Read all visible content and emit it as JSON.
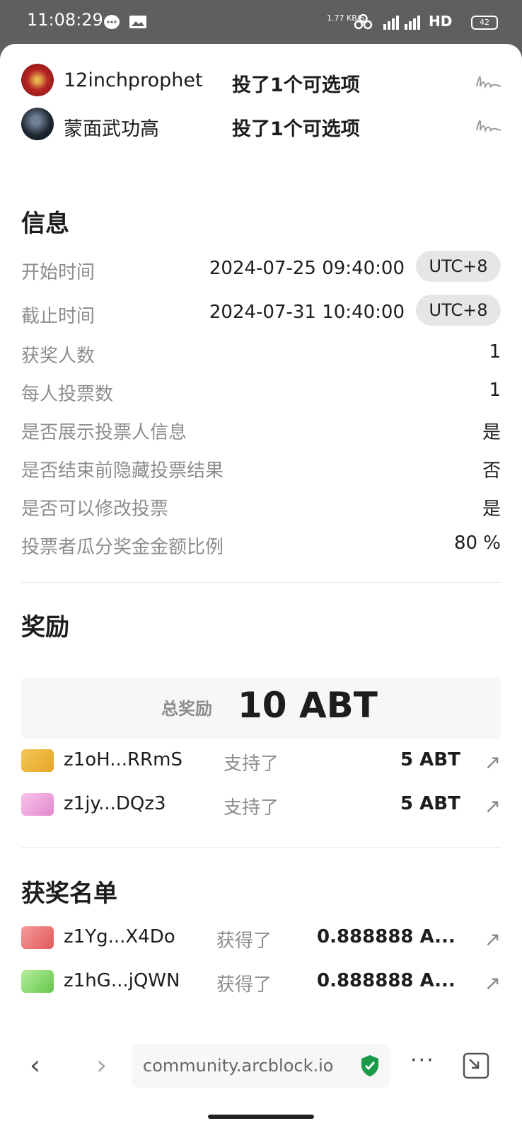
{
  "status_bar": {
    "time": "11:08:29",
    "net_speed": "1.77 KB/S",
    "network": "5G 4G HD",
    "battery": "42"
  },
  "voters": [
    {
      "name": "12inchprophet",
      "action": "投了1个可选项",
      "avatar_color": "#b62424"
    },
    {
      "name": "蒙面武功高",
      "action": "投了1个可选项",
      "avatar_color": "#1f2730"
    }
  ],
  "info": {
    "title": "信息",
    "rows": [
      {
        "label": "开始时间",
        "value": "2024-07-25 09:40:00",
        "tz": "UTC+8"
      },
      {
        "label": "截止时间",
        "value": "2024-07-31 10:40:00",
        "tz": "UTC+8"
      },
      {
        "label": "获奖人数",
        "value": "1"
      },
      {
        "label": "每人投票数",
        "value": "1"
      },
      {
        "label": "是否展示投票人信息",
        "value": "是"
      },
      {
        "label": "是否结束前隐藏投票结果",
        "value": "否"
      },
      {
        "label": "是否可以修改投票",
        "value": "是"
      },
      {
        "label": "投票者瓜分奖金金额比例",
        "value": "80 %"
      }
    ]
  },
  "rewards": {
    "title": "奖励",
    "total_label": "总奖励",
    "total_amount": "10 ABT",
    "supporters": [
      {
        "address": "z1oH...RRmS",
        "verb": "支持了",
        "amount": "5 ABT",
        "chip_color": "#eab03a"
      },
      {
        "address": "z1jy...DQz3",
        "verb": "支持了",
        "amount": "5 ABT",
        "chip_color": "#eda0d6"
      }
    ]
  },
  "winners": {
    "title": "获奖名单",
    "items": [
      {
        "address": "z1Yg...X4Do",
        "verb": "获得了",
        "amount": "0.888888 A...",
        "chip_color": "#e96a6a"
      },
      {
        "address": "z1hG...jQWN",
        "verb": "获得了",
        "amount": "0.888888 A...",
        "chip_color": "#7fd36a"
      }
    ]
  },
  "browser": {
    "url": "community.arcblock.io",
    "back": "‹",
    "forward": "›",
    "more": "···"
  },
  "colors": {
    "secure_shield": "#1a9a4a"
  }
}
